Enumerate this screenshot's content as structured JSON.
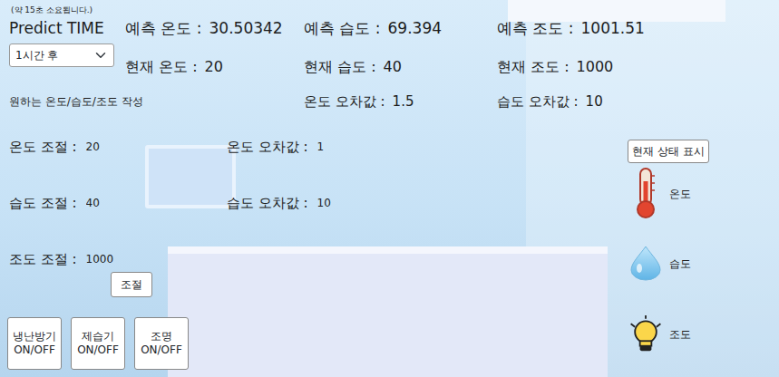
{
  "note": "(약 15초 소요됩니다.)",
  "predict": {
    "title": "Predict TIME",
    "time_select": "1시간 후",
    "values": [
      {
        "label": "예측 온도 :",
        "value": "30.50342"
      },
      {
        "label": "예측 습도 :",
        "value": "69.394"
      },
      {
        "label": "예측 조도 :",
        "value": "1001.51"
      }
    ]
  },
  "current": [
    {
      "label": "현재 온도 :",
      "value": "20"
    },
    {
      "label": "현재 습도 :",
      "value": "40"
    },
    {
      "label": "현재 조도 :",
      "value": "1000"
    }
  ],
  "form_title": "원하는 온도/습도/조도 작성",
  "current_error": [
    {
      "label": "온도 오차값 :",
      "value": "1.5"
    },
    {
      "label": "습도 오차값 :",
      "value": "10"
    }
  ],
  "controls": [
    {
      "label": "온도 조절 :",
      "value": "20",
      "error_label": "온도 오차값 :",
      "error_value": "1"
    },
    {
      "label": "습도 조절 :",
      "value": "40",
      "error_label": "습도 오차값 :",
      "error_value": "10"
    },
    {
      "label": "조도 조절 :",
      "value": "1000"
    }
  ],
  "apply_button": "조절",
  "device_buttons": [
    {
      "line1": "냉난방기",
      "line2": "ON/OFF"
    },
    {
      "line1": "제습기",
      "line2": "ON/OFF"
    },
    {
      "line1": "조명",
      "line2": "ON/OFF"
    }
  ],
  "status": {
    "button": "현재 상태 표시",
    "items": [
      {
        "label": "온도",
        "kind": "thermometer"
      },
      {
        "label": "습도",
        "kind": "drop"
      },
      {
        "label": "조도",
        "kind": "bulb"
      }
    ]
  }
}
